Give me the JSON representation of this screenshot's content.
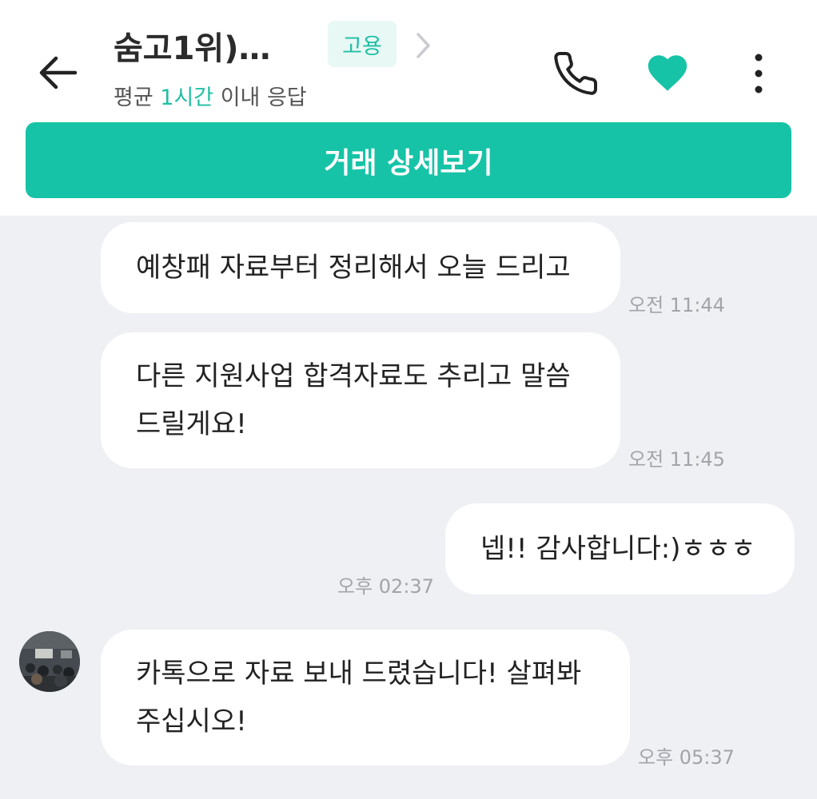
{
  "header": {
    "title": "숨고1위)…",
    "badge": "고용",
    "response_prefix": "평균 ",
    "response_highlight": "1시간",
    "response_suffix": " 이내 응답",
    "deal_button": "거래 상세보기"
  },
  "messages": [
    {
      "sender": "them",
      "lines": [
        "예창패 자료부터 정리해서 오늘 드리고"
      ],
      "time": "오전 11:44"
    },
    {
      "sender": "them",
      "lines": [
        "다른 지원사업 합격자료도 추리고 말씀",
        "드릴게요!"
      ],
      "time": "오전 11:45"
    },
    {
      "sender": "me",
      "lines": [
        "넵!! 감사합니다:)ㅎㅎㅎ"
      ],
      "time": "오후 02:37"
    },
    {
      "sender": "them",
      "lines": [
        "카톡으로 자료 보내 드렸습니다! 살펴봐",
        "주십시오!"
      ],
      "time": "오후 05:37"
    }
  ],
  "colors": {
    "accent": "#17c3a7",
    "chat_bg": "#eff0f4",
    "bubble": "#ffffff",
    "time": "#a2a4aa"
  }
}
